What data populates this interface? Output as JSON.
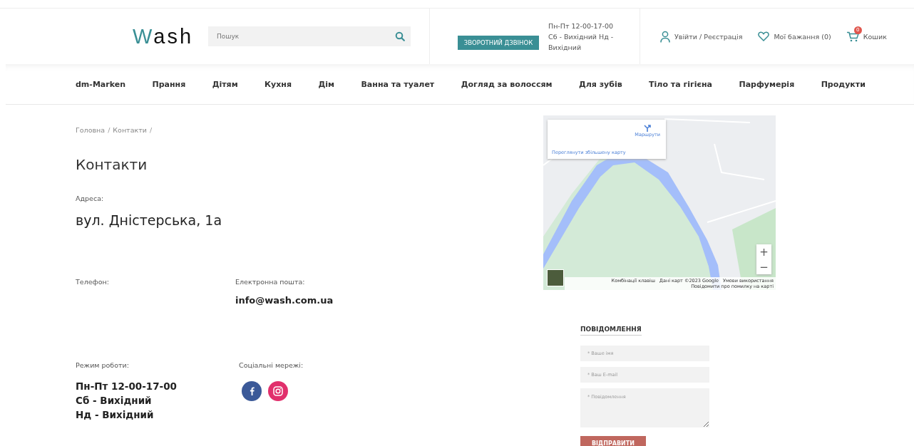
{
  "header": {
    "logo": [
      {
        "text": "W",
        "accent": true
      },
      {
        "text": "ash",
        "accent": false
      }
    ],
    "search": {
      "placeholder": "Пошук"
    },
    "callback_button": "ЗВОРОТНИЙ ДЗВІНОК",
    "schedule": "Пн-Пт 12-00-17-00 Сб - Вихідний Нд - Вихідний",
    "login": "Увійти / Реєстрація",
    "wishlist": "Мої бажання (0)",
    "cart": {
      "label": "Кошик",
      "count": "0"
    }
  },
  "nav": [
    "dm-Marken",
    "Прання",
    "Дітям",
    "Кухня",
    "Дім",
    "Ванна та туалет",
    "Догляд за волоссям",
    "Для зубів",
    "Тіло та гігієна",
    "Парфумерія",
    "Продукти"
  ],
  "breadcrumbs": [
    {
      "kind": "link",
      "text": "Головна"
    },
    {
      "kind": "separator",
      "text": "/"
    },
    {
      "kind": "link",
      "text": "Контакти"
    },
    {
      "kind": "separator",
      "text": "/"
    }
  ],
  "title": "Контакти",
  "address": {
    "label": "Адреса:",
    "value": "вул. Дністерська, 1а"
  },
  "phone": {
    "label": "Телефон:"
  },
  "email": {
    "label": "Електронна пошта:",
    "value": "info@wash.com.ua"
  },
  "hours": {
    "label": "Режим роботи:",
    "lines": [
      "Пн-Пт 12-00-17-00",
      "Сб - Вихідний",
      "Нд - Вихідний"
    ]
  },
  "social": {
    "label": "Соціальні мережі:",
    "networks": [
      {
        "kind": "facebook",
        "color": "#3b5998"
      },
      {
        "kind": "instagram",
        "color": "#e1306c"
      }
    ]
  },
  "map": {
    "directions": "Маршрути",
    "larger_map": "Переглянути збільшену карту",
    "zoom_in": "+",
    "zoom_out": "−",
    "footer": [
      "Комбінації клавіш",
      "Дані карт ©2023 Google",
      "Умови використання",
      "Повідомити про помилку на карті"
    ]
  },
  "form": {
    "title": "ПОВІДОМЛЕННЯ",
    "fields": [
      {
        "kind": "input",
        "placeholder": "* Ваше імя"
      },
      {
        "kind": "input",
        "placeholder": "* Ваш E-mail"
      },
      {
        "kind": "textarea",
        "placeholder": "* Повідомлення"
      }
    ],
    "submit": "ВІДПРАВИТИ"
  }
}
